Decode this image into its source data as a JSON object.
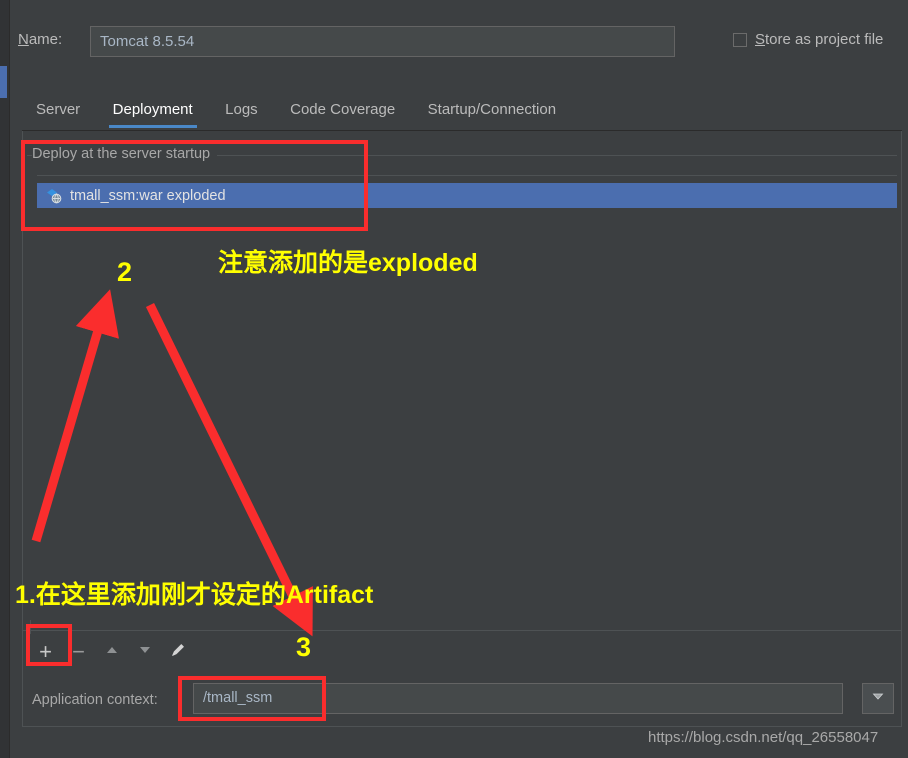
{
  "window": {
    "name_label": "Name:",
    "name_mnemonic": "N",
    "name_label_rest": "ame:",
    "name_value": "Tomcat 8.5.54",
    "store_as_project_file_mnemonic": "S",
    "store_as_project_file_rest": "tore as project file",
    "store_checked": false
  },
  "tabs": [
    {
      "label": "Server",
      "active": false
    },
    {
      "label": "Deployment",
      "active": true
    },
    {
      "label": "Logs",
      "active": false
    },
    {
      "label": "Code Coverage",
      "active": false
    },
    {
      "label": "Startup/Connection",
      "active": false
    }
  ],
  "deployment": {
    "group_title": "Deploy at the server startup",
    "rows": [
      {
        "label": "tmall_ssm:war exploded",
        "icon": "artifact-icon",
        "selected": true
      }
    ],
    "toolbar": [
      {
        "name": "add-button",
        "glyph": "+"
      },
      {
        "name": "remove-button",
        "glyph": "−"
      },
      {
        "name": "move-up-button",
        "glyph": "▲"
      },
      {
        "name": "move-down-button",
        "glyph": "▼"
      },
      {
        "name": "edit-button",
        "glyph": "✎"
      }
    ],
    "application_context_label": "Application context:",
    "application_context_value": "/tmall_ssm",
    "dropdown_icon": "chevron-down-icon"
  },
  "annotations": {
    "note_exploded": "注意添加的是exploded",
    "note_artifact": "1.在这里添加刚才设定的Artifact",
    "number_two": "2",
    "number_three": "3",
    "red_color": "#fa2d2d",
    "yellow_color": "#ffff00"
  },
  "watermark": "https://blog.csdn.net/qq_26558047"
}
